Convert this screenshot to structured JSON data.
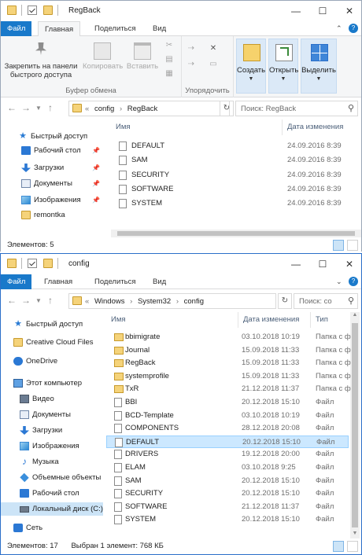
{
  "colors": {
    "accent": "#1979ca",
    "selection": "#cce8ff",
    "folder": "#f5d37a"
  },
  "window1": {
    "title": "RegBack",
    "tabs": {
      "file": "Файл",
      "home": "Главная",
      "share": "Поделиться",
      "view": "Вид"
    },
    "ribbon": {
      "pin": "Закрепить на панели быстрого доступа",
      "copy": "Копировать",
      "paste": "Вставить",
      "clipboard_group": "Буфер обмена",
      "organize_group": "Упорядочить",
      "create": "Создать",
      "open": "Открыть",
      "select": "Выделить"
    },
    "address": {
      "sep": "«",
      "parts": [
        "config",
        "RegBack"
      ]
    },
    "search_placeholder": "Поиск: RegBack",
    "nav": [
      {
        "label": "Быстрый доступ",
        "icon": "star-icon"
      },
      {
        "label": "Рабочий стол",
        "icon": "desktop-icon",
        "pin": "📌"
      },
      {
        "label": "Загрузки",
        "icon": "downloads-icon",
        "pin": "📌"
      },
      {
        "label": "Документы",
        "icon": "documents-icon",
        "pin": "📌"
      },
      {
        "label": "Изображения",
        "icon": "pictures-icon",
        "pin": "📌"
      },
      {
        "label": "remontka",
        "icon": "folder-icon"
      }
    ],
    "columns": {
      "name": "Имя",
      "date": "Дата изменения"
    },
    "files": [
      {
        "name": "DEFAULT",
        "date": "24.09.2016 8:39"
      },
      {
        "name": "SAM",
        "date": "24.09.2016 8:39"
      },
      {
        "name": "SECURITY",
        "date": "24.09.2016 8:39"
      },
      {
        "name": "SOFTWARE",
        "date": "24.09.2016 8:39"
      },
      {
        "name": "SYSTEM",
        "date": "24.09.2016 8:39"
      }
    ],
    "status": {
      "count": "Элементов: 5"
    }
  },
  "window2": {
    "title": "config",
    "tabs": {
      "file": "Файл",
      "home": "Главная",
      "share": "Поделиться",
      "view": "Вид"
    },
    "address": {
      "sep": "«",
      "parts": [
        "Windows",
        "System32",
        "config"
      ]
    },
    "search_placeholder": "Поиск: co",
    "nav": [
      {
        "label": "Быстрый доступ",
        "icon": "star-icon"
      },
      {
        "label": "Creative Cloud Files",
        "icon": "creative-cloud-icon"
      },
      {
        "label": "OneDrive",
        "icon": "onedrive-icon"
      },
      {
        "label": "Этот компьютер",
        "icon": "computer-icon"
      },
      {
        "label": "Видео",
        "icon": "video-icon"
      },
      {
        "label": "Документы",
        "icon": "documents-icon"
      },
      {
        "label": "Загрузки",
        "icon": "downloads-icon"
      },
      {
        "label": "Изображения",
        "icon": "pictures-icon"
      },
      {
        "label": "Музыка",
        "icon": "music-icon"
      },
      {
        "label": "Объемные объекты",
        "icon": "3d-objects-icon"
      },
      {
        "label": "Рабочий стол",
        "icon": "desktop-icon"
      },
      {
        "label": "Локальный диск (C:)",
        "icon": "drive-icon"
      },
      {
        "label": "Сеть",
        "icon": "network-icon"
      }
    ],
    "columns": {
      "name": "Имя",
      "date": "Дата изменения",
      "type": "Тип"
    },
    "files": [
      {
        "name": "bbimigrate",
        "date": "03.10.2018 10:19",
        "type": "Папка с ф",
        "folder": true
      },
      {
        "name": "Journal",
        "date": "15.09.2018 11:33",
        "type": "Папка с ф",
        "folder": true
      },
      {
        "name": "RegBack",
        "date": "15.09.2018 11:33",
        "type": "Папка с ф",
        "folder": true
      },
      {
        "name": "systemprofile",
        "date": "15.09.2018 11:33",
        "type": "Папка с ф",
        "folder": true
      },
      {
        "name": "TxR",
        "date": "21.12.2018 11:37",
        "type": "Папка с ф",
        "folder": true
      },
      {
        "name": "BBI",
        "date": "20.12.2018 15:10",
        "type": "Файл",
        "folder": false
      },
      {
        "name": "BCD-Template",
        "date": "03.10.2018 10:19",
        "type": "Файл",
        "folder": false
      },
      {
        "name": "COMPONENTS",
        "date": "28.12.2018 20:08",
        "type": "Файл",
        "folder": false
      },
      {
        "name": "DEFAULT",
        "date": "20.12.2018 15:10",
        "type": "Файл",
        "folder": false,
        "selected": true
      },
      {
        "name": "DRIVERS",
        "date": "19.12.2018 20:00",
        "type": "Файл",
        "folder": false
      },
      {
        "name": "ELAM",
        "date": "03.10.2018 9:25",
        "type": "Файл",
        "folder": false
      },
      {
        "name": "SAM",
        "date": "20.12.2018 15:10",
        "type": "Файл",
        "folder": false
      },
      {
        "name": "SECURITY",
        "date": "20.12.2018 15:10",
        "type": "Файл",
        "folder": false
      },
      {
        "name": "SOFTWARE",
        "date": "21.12.2018 11:37",
        "type": "Файл",
        "folder": false
      },
      {
        "name": "SYSTEM",
        "date": "20.12.2018 15:10",
        "type": "Файл",
        "folder": false
      }
    ],
    "status": {
      "count": "Элементов: 17",
      "selected": "Выбран 1 элемент: 768 КБ"
    }
  }
}
